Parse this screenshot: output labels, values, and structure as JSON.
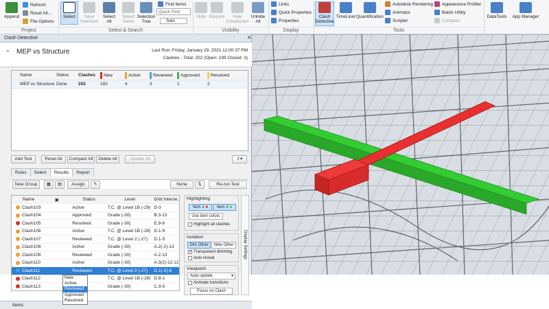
{
  "ribbon": {
    "append": "Append",
    "refresh": "Refresh",
    "reset_all": "Reset All...",
    "file_options": "File Options",
    "select": "Select",
    "save_selection": "Save Selection",
    "select_all": "Select All",
    "select_same": "Select Same",
    "selection_tree": "Selection Tree",
    "find_items": "Find Items",
    "quick_find_placeholder": "Quick Find",
    "sets": "Sets",
    "hide": "Hide",
    "require": "Require",
    "hide_unselected": "Hide Unselected",
    "unhide_all": "Unhide All",
    "links": "Links",
    "quick_properties": "Quick Properties",
    "properties": "Properties",
    "clash_detective": "Clash Detective",
    "timeliner": "TimeLiner",
    "quantification": "Quantification",
    "autodesk_rendering": "Autodesk Rendering",
    "animator": "Animator",
    "scripter": "Scripter",
    "appearance_profiler": "Appearance Profiler",
    "batch_utility": "Batch Utility",
    "compare": "Compare",
    "datatools": "DataTools",
    "app_manager": "App Manager",
    "groups": {
      "project": "Project",
      "select_search": "Select & Search",
      "visibility": "Visibility",
      "display": "Display",
      "tools": "Tools"
    }
  },
  "panel": {
    "title": "Clash Detective",
    "test_name": "MEP vs Structure",
    "last_run": "Last Run:  Friday, January 29, 2021 12:00:37 PM",
    "clash_summary": "Clashes -  Total: 202  (Open: 199  Closed: 3)",
    "tests_headers": [
      "Name",
      "Status",
      "Clashes",
      "New",
      "Active",
      "Reviewed",
      "Approved",
      "Resolved"
    ],
    "tests_row": [
      "MEP vs Structure",
      "Done",
      "202",
      "192",
      "4",
      "3",
      "1",
      "2"
    ],
    "buttons": {
      "add_test": "Add Test",
      "reset_all": "Reset All",
      "compact_all": "Compact All",
      "delete_all": "Delete All",
      "update_all": "Update All"
    },
    "tabs": [
      "Rules",
      "Select",
      "Results",
      "Report"
    ],
    "results_toolbar": {
      "new_group": "New Group",
      "assign": "Assign",
      "none": "None",
      "rerun": "Re-run Test"
    },
    "results_headers": [
      "Name",
      "Status",
      "Level",
      "Grid Interse..."
    ],
    "results": [
      {
        "name": "Clash103",
        "color": "#f0a030",
        "status": "Active",
        "level": "T.C. @ Level 1B (-29)",
        "grid": "D-3"
      },
      {
        "name": "Clash104",
        "color": "#f0a030",
        "status": "Approved",
        "level": "Grade (-30)",
        "grid": "B.3-13"
      },
      {
        "name": "Clash105",
        "color": "#d93025",
        "status": "Resolved",
        "level": "Grade (-30)",
        "grid": "E.9-9"
      },
      {
        "name": "Clash106",
        "color": "#f0a030",
        "status": "Active",
        "level": "T.C. @ Level 1B (-28)",
        "grid": "D.1-9"
      },
      {
        "name": "Clash107",
        "color": "#f0a030",
        "status": "Reviewed",
        "level": "T.C. @ Level 2 (-27)",
        "grid": "D.1-5"
      },
      {
        "name": "Clash108",
        "color": "#f0a030",
        "status": "Active",
        "level": "Grade (-30)",
        "grid": "A.2(-2)-13"
      },
      {
        "name": "Clash109",
        "color": "#f0a030",
        "status": "Reviewed",
        "level": "Grade (-30)",
        "grid": "A.2-13"
      },
      {
        "name": "Clash110",
        "color": "#f0a030",
        "status": "Active",
        "level": "Grade (-30)",
        "grid": "A.3(2)-12.12"
      },
      {
        "name": "Clash111",
        "color": "#4aa0e6",
        "status": "Reviewed",
        "level": "T.C. @ Level 2 (-27)",
        "grid": "D.1(-2)-6"
      },
      {
        "name": "Clash112",
        "color": "#d93025",
        "status": "",
        "level": "T.C. @ Level 1B (-28)",
        "grid": "D.8-1"
      },
      {
        "name": "Clash113",
        "color": "#d93025",
        "status": "",
        "level": "Grade (-30)",
        "grid": "C.9-5"
      }
    ],
    "dropdown": [
      "New",
      "Active",
      "Reviewed",
      "Approved",
      "Resolved"
    ],
    "highlighting": {
      "title": "Highlighting",
      "item1": "Item 1",
      "item2": "Item 2",
      "use_item_colors": "Use item colors",
      "highlight_all": "Highlight all clashes"
    },
    "isolation": {
      "title": "Isolation",
      "dim_other": "Dim Other",
      "hide_other": "Hide Other",
      "transparent": "Transparent dimming",
      "auto_reveal": "Auto reveal"
    },
    "viewpoint": {
      "title": "Viewpoint",
      "mode": "Auto-update",
      "animate": "Animate transitions",
      "focus": "Focus on Clash"
    },
    "display_settings": "Display Settings",
    "items": "Items"
  },
  "colors": {
    "new": "#d93025",
    "active": "#f0a030",
    "reviewed": "#4aa0e6",
    "approved": "#4caf50",
    "resolved": "#f5d142",
    "clash_green": "#33cc33",
    "clash_red": "#e83030"
  }
}
